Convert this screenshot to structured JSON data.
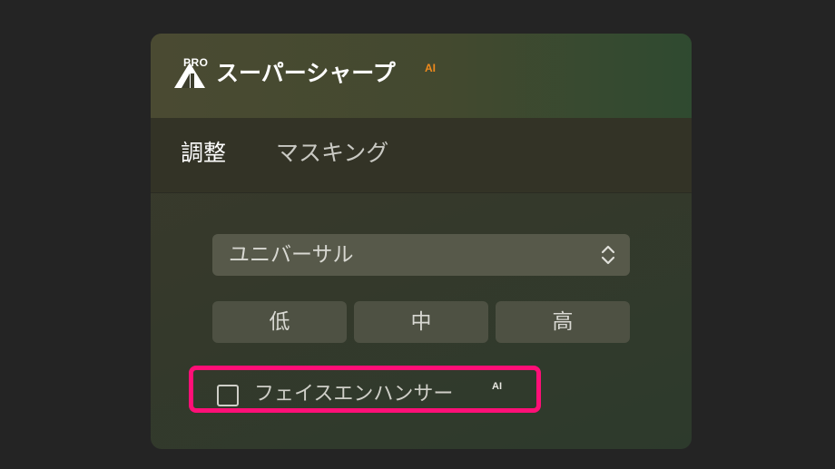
{
  "panel": {
    "badge": "PRO",
    "title": "スーパーシャープ",
    "title_ai": "AI",
    "logo_icon": "pro-sharpen-logo-icon"
  },
  "tabs": [
    {
      "label": "調整",
      "active": true
    },
    {
      "label": "マスキング",
      "active": false
    }
  ],
  "mode_select": {
    "value": "ユニバーサル",
    "icon": "chevron-updown-icon"
  },
  "strength": {
    "options": [
      "低",
      "中",
      "高"
    ]
  },
  "face_enhancer": {
    "label": "フェイスエンハンサー",
    "ai_badge": "AI",
    "checked": false
  },
  "colors": {
    "accent_ai": "#f08a1c",
    "highlight": "#ff0f77",
    "background": "#242424"
  }
}
